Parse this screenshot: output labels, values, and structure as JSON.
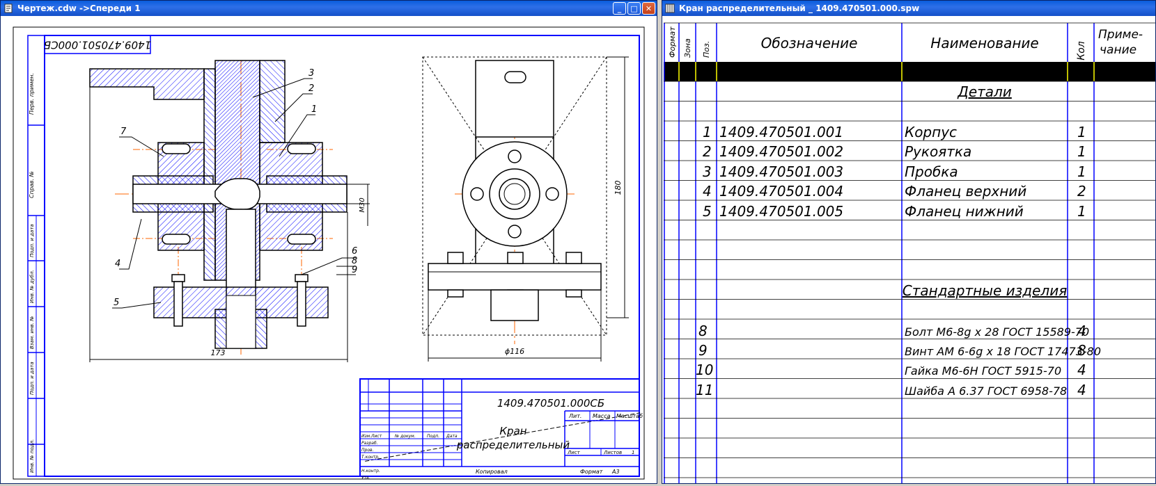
{
  "drawing_window": {
    "title": "Чертеж.cdw ->Спереди 1",
    "doc_code_mirrored": "1409.470501.000СБ",
    "stamp_code": "1409.470501.000СБ",
    "stamp_title_1": "Кран",
    "stamp_title_2": "распределительный",
    "left_strip_labels": [
      "Перв. примен.",
      "Справ. №",
      "Подп. и дата",
      "Инв. № дубл.",
      "Взам. инв. №",
      "Подп. и дата",
      "Инв. № подл."
    ],
    "stamp_headers": [
      "Изм.",
      "Лист",
      "№ докум.",
      "Подп.",
      "Дата"
    ],
    "stamp_rows": [
      "Разраб.",
      "Пров.",
      "Т.контр.",
      "Н.контр.",
      "Утв."
    ],
    "stamp_lit": "Лит.",
    "stamp_mass": "Масса",
    "stamp_scale": "Масштаб",
    "stamp_sheet": "Лист",
    "stamp_sheets": "Листов",
    "stamp_sheets_count": "1",
    "copied": "Копировал",
    "format": "Формат",
    "format_value": "A3",
    "dim_173": "173",
    "dim_m30": "M30",
    "dim_180": "180",
    "dim_phi116": "ϕ116",
    "callouts": [
      "3",
      "2",
      "1",
      "7",
      "4",
      "5",
      "6",
      "8",
      "9"
    ]
  },
  "spec_window": {
    "title": "Кран распределительный _ 1409.470501.000.spw",
    "headers": {
      "format": "Формат",
      "zone": "Зона",
      "pos": "Поз.",
      "designation": "Обозначение",
      "name": "Наименование",
      "qty": "Кол",
      "note_1": "Приме-",
      "note_2": "чание"
    },
    "section_details": "Детали",
    "section_standard": "Стандартные изделия",
    "details": [
      {
        "pos": "1",
        "designation": "1409.470501.001",
        "name": "Корпус",
        "qty": "1"
      },
      {
        "pos": "2",
        "designation": "1409.470501.002",
        "name": "Рукоятка",
        "qty": "1"
      },
      {
        "pos": "3",
        "designation": "1409.470501.003",
        "name": "Пробка",
        "qty": "1"
      },
      {
        "pos": "4",
        "designation": "1409.470501.004",
        "name": "Фланец верхний",
        "qty": "2"
      },
      {
        "pos": "5",
        "designation": "1409.470501.005",
        "name": "Фланец нижний",
        "qty": "1"
      }
    ],
    "standard": [
      {
        "pos": "8",
        "name": "Болт М6-8g x 28 ГОСТ 15589-70",
        "qty": "4"
      },
      {
        "pos": "9",
        "name": "Винт АМ 6-6g x 18 ГОСТ 17473-80",
        "qty": "8"
      },
      {
        "pos": "10",
        "name": "Гайка М6-6Н ГОСТ 5915-70",
        "qty": "4"
      },
      {
        "pos": "11",
        "name": "Шайба А  6.37 ГОСТ 6958-78",
        "qty": "4"
      }
    ]
  },
  "colors": {
    "title_bar": "#0a5ddc",
    "frame": "#0000ff",
    "axis": "#ff6600",
    "highlight_row": "#000000",
    "highlight_lines": "#ffff00"
  }
}
